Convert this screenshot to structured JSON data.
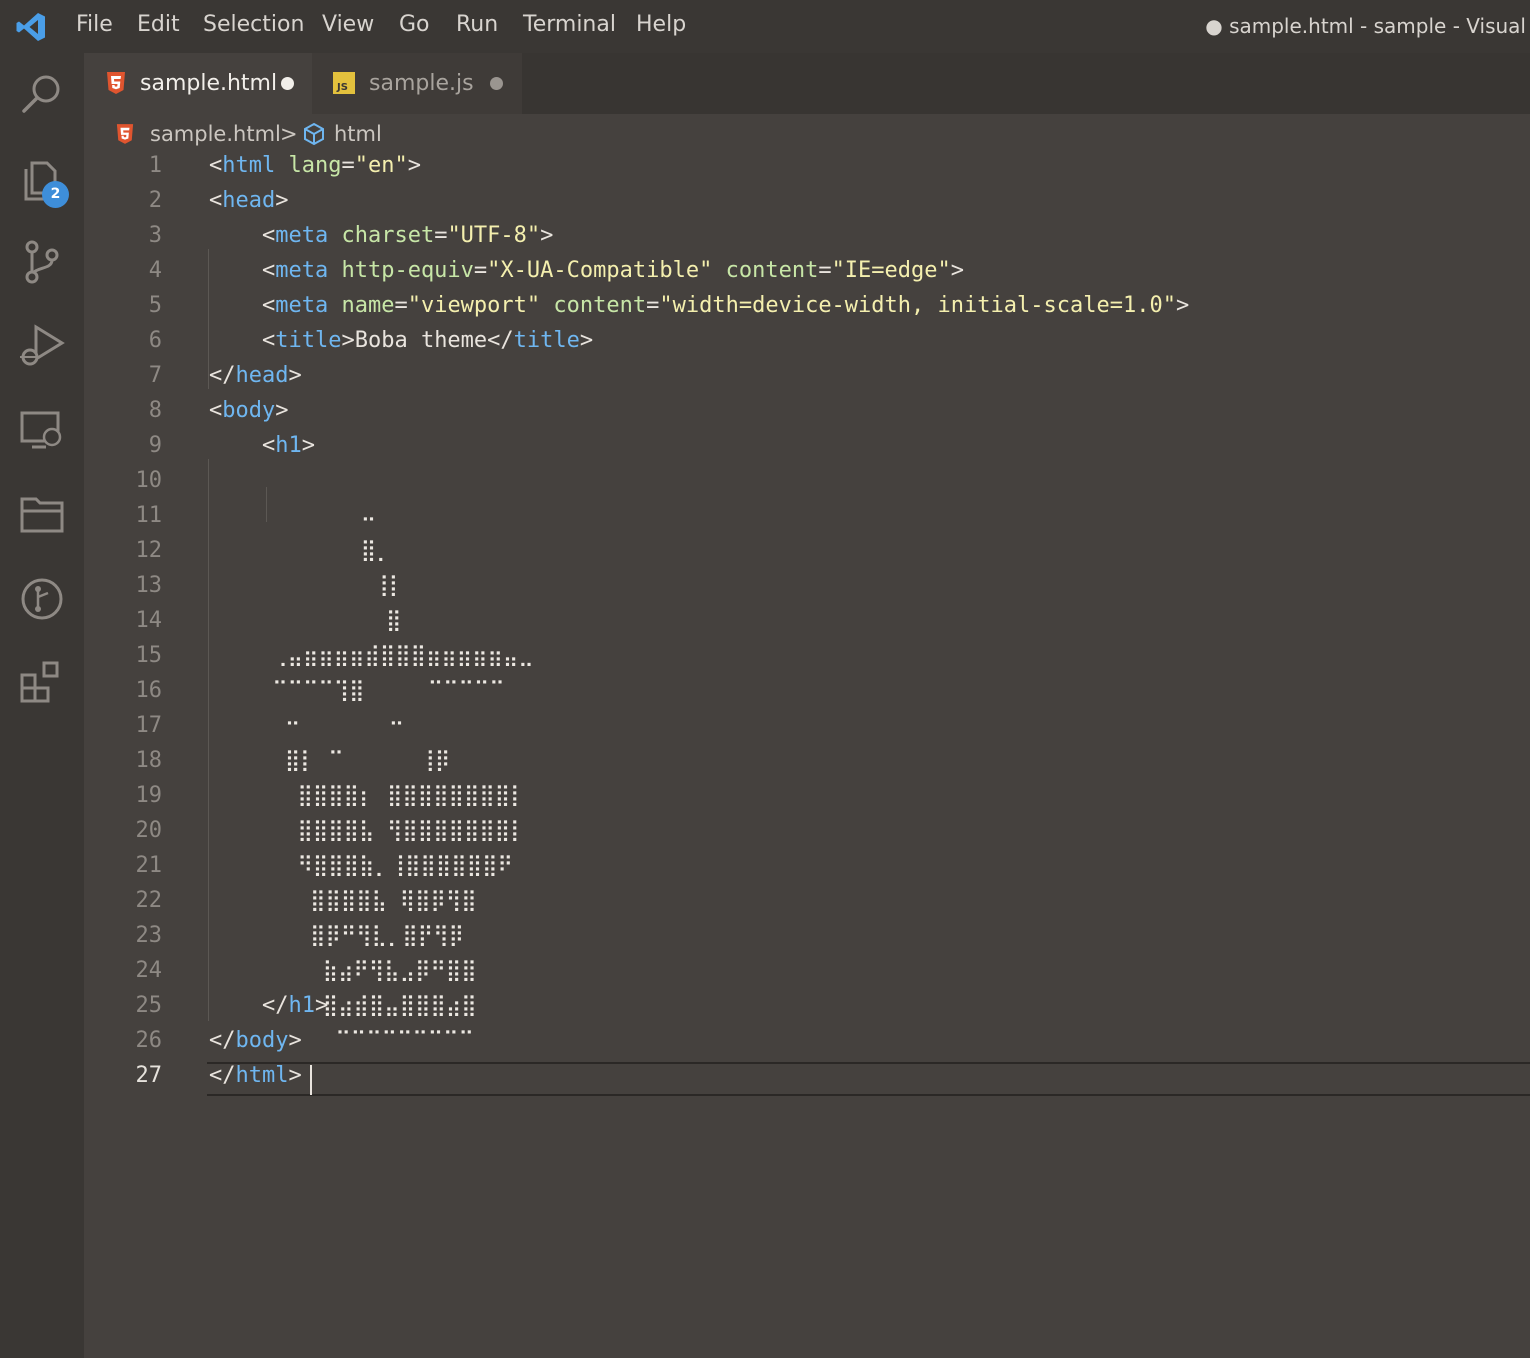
{
  "titlebar": {
    "menu": [
      "File",
      "Edit",
      "Selection",
      "View",
      "Go",
      "Run",
      "Terminal",
      "Help"
    ],
    "window_title": "● sample.html - sample - Visual"
  },
  "activity_bar": {
    "items": [
      "search-icon",
      "explorer-icon",
      "source-control-icon",
      "run-debug-icon",
      "remote-explorer-icon",
      "folder-icon",
      "timeline-icon",
      "extensions-icon"
    ],
    "explorer_badge": "2",
    "badge_color": "#3e8ed9"
  },
  "tabs": [
    {
      "label": "sample.html",
      "icon": "html5-icon",
      "active": true,
      "modified": true
    },
    {
      "label": "sample.js",
      "icon": "js-icon",
      "active": false,
      "modified": true
    }
  ],
  "breadcrumb": {
    "file": "sample.html",
    "separator": ">",
    "symbol": "html"
  },
  "editor": {
    "current_line": 27,
    "line_numbers": [
      "1",
      "2",
      "3",
      "4",
      "5",
      "6",
      "7",
      "8",
      "9",
      "10",
      "11",
      "12",
      "13",
      "14",
      "15",
      "16",
      "17",
      "18",
      "19",
      "20",
      "21",
      "22",
      "23",
      "24",
      "25",
      "26",
      "27"
    ],
    "lines": {
      "l1": [
        [
          "p",
          "<"
        ],
        [
          "t",
          "html"
        ],
        [
          "x",
          " "
        ],
        [
          "a",
          "lang"
        ],
        [
          "p",
          "="
        ],
        [
          "s",
          "\"en\""
        ],
        [
          "p",
          ">"
        ]
      ],
      "l2": [
        [
          "p",
          "<"
        ],
        [
          "t",
          "head"
        ],
        [
          "p",
          ">"
        ]
      ],
      "l3": [
        [
          "x",
          "    "
        ],
        [
          "p",
          "<"
        ],
        [
          "t",
          "meta"
        ],
        [
          "x",
          " "
        ],
        [
          "a",
          "charset"
        ],
        [
          "p",
          "="
        ],
        [
          "s",
          "\"UTF-8\""
        ],
        [
          "p",
          ">"
        ]
      ],
      "l4": [
        [
          "x",
          "    "
        ],
        [
          "p",
          "<"
        ],
        [
          "t",
          "meta"
        ],
        [
          "x",
          " "
        ],
        [
          "a",
          "http-equiv"
        ],
        [
          "p",
          "="
        ],
        [
          "s",
          "\"X-UA-Compatible\""
        ],
        [
          "x",
          " "
        ],
        [
          "a",
          "content"
        ],
        [
          "p",
          "="
        ],
        [
          "s",
          "\"IE=edge\""
        ],
        [
          "p",
          ">"
        ]
      ],
      "l5": [
        [
          "x",
          "    "
        ],
        [
          "p",
          "<"
        ],
        [
          "t",
          "meta"
        ],
        [
          "x",
          " "
        ],
        [
          "a",
          "name"
        ],
        [
          "p",
          "="
        ],
        [
          "s",
          "\"viewport\""
        ],
        [
          "x",
          " "
        ],
        [
          "a",
          "content"
        ],
        [
          "p",
          "="
        ],
        [
          "s",
          "\"width=device-width, initial-scale=1.0\""
        ],
        [
          "p",
          ">"
        ]
      ],
      "l6": [
        [
          "x",
          "    "
        ],
        [
          "p",
          "<"
        ],
        [
          "t",
          "title"
        ],
        [
          "p",
          ">"
        ],
        [
          "x",
          "Boba theme"
        ],
        [
          "p",
          "</"
        ],
        [
          "t",
          "title"
        ],
        [
          "p",
          ">"
        ]
      ],
      "l7": [
        [
          "p",
          "</"
        ],
        [
          "t",
          "head"
        ],
        [
          "p",
          ">"
        ]
      ],
      "l8": [
        [
          "p",
          "<"
        ],
        [
          "t",
          "body"
        ],
        [
          "p",
          ">"
        ]
      ],
      "l9": [
        [
          "x",
          "    "
        ],
        [
          "p",
          "<"
        ],
        [
          "t",
          "h1"
        ],
        [
          "p",
          ">"
        ]
      ],
      "l25": [
        [
          "x",
          "    "
        ],
        [
          "p",
          "</"
        ],
        [
          "t",
          "h1"
        ],
        [
          "p",
          ">"
        ]
      ],
      "l26": [
        [
          "p",
          "</"
        ],
        [
          "t",
          "body"
        ],
        [
          "p",
          ">"
        ]
      ],
      "l27": [
        [
          "p",
          "</"
        ],
        [
          "t",
          "html"
        ],
        [
          "p",
          ">"
        ]
      ]
    },
    "ascii_art": [
      "",
      "            ⠤",
      "            ⣿⡀",
      "             ⢸⡇",
      "              ⣿",
      "     ⢀⣤⣶⣶⣶⣶⣾⣿⣿⣿⣶⣶⣶⣶⣶⣤⣀",
      "     ⠉⠉⠉⠉⢹⣿     ⠉⠉⠉⠉⠉",
      "      ⠒       ⠒",
      "      ⣿⡇ ⠉      ⢸⡿",
      "       ⣿⣿⣿⣿⡆ ⣿⣿⣿⣿⣿⣿⣿⣿⡇",
      "       ⣿⣿⣿⣿⣧ ⢻⣿⣿⣿⣿⣿⣿⣿⡇",
      "       ⠻⣿⣿⣿⣷⡀⢸⣿⣿⣿⣿⣿⣿⠟",
      "        ⣿⣿⣿⣿⣧ ⢿⣿⡿⢻⣿",
      "        ⣿⡿⠛⢻⣇⡀⣿⡟⢻⡿",
      "         ⣷⣴⠟⢻⣧⣠⡿⠛⣿⣿",
      "         ⣿⣴⣾⣿⣤⣿⣿⣿⣴⣿",
      "          ⠉⠉⠉⠉⠉⠉⠉⠉⠉"
    ]
  },
  "colors": {
    "background": "#45413e",
    "sidebar": "#3a3734",
    "tag": "#6fb6f0",
    "attribute": "#c7e6a7",
    "string": "#f4efae"
  }
}
